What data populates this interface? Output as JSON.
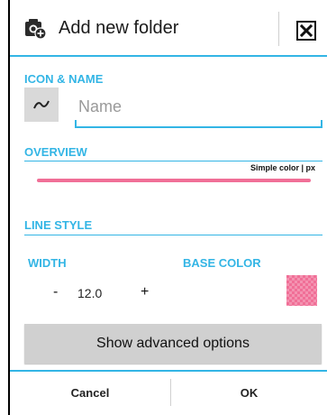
{
  "dialog": {
    "title": "Add new folder",
    "title_icon": "add-folder-icon",
    "close_icon": "close-icon"
  },
  "icon_name_section": {
    "header": "ICON & NAME",
    "icon_button_icon": "wave-icon",
    "name_input": {
      "value": "",
      "placeholder": "Name"
    }
  },
  "overview_section": {
    "header": "OVERVIEW",
    "preview_caption": "Simple color | px",
    "line_color": "#f06f97"
  },
  "line_style_section": {
    "header": "LINE STYLE",
    "width_label": "WIDTH",
    "base_color_label": "BASE COLOR",
    "decrement_label": "-",
    "width_value": "12.0",
    "increment_label": "+",
    "base_color": "#f06f97"
  },
  "advanced_button_label": "Show advanced options",
  "footer": {
    "cancel_label": "Cancel",
    "ok_label": "OK"
  },
  "colors": {
    "accent": "#33b5e5",
    "line": "#f06f97"
  }
}
